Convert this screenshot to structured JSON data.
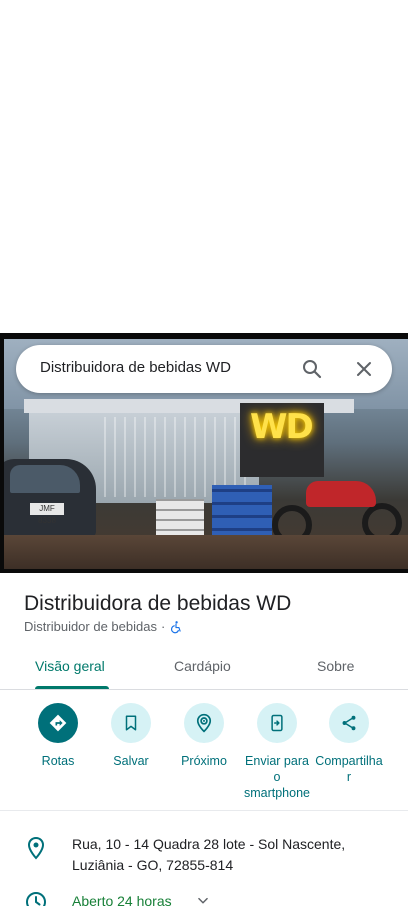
{
  "search": {
    "query": "Distribuidora de bebidas WD"
  },
  "photo": {
    "sign_text": "WD",
    "plate_text": "JMF 8338"
  },
  "place": {
    "title": "Distribuidora de bebidas WD",
    "category": "Distribuidor de bebidas",
    "separator": "·"
  },
  "tabs": [
    {
      "label": "Visão geral",
      "active": true
    },
    {
      "label": "Cardápio",
      "active": false
    },
    {
      "label": "Sobre",
      "active": false
    }
  ],
  "actions": [
    {
      "label": "Rotas",
      "icon": "directions-icon"
    },
    {
      "label": "Salvar",
      "icon": "bookmark-icon"
    },
    {
      "label": "Próximo",
      "icon": "nearby-icon"
    },
    {
      "label_lines": [
        "Enviar para",
        "o",
        "smartphone"
      ],
      "icon": "send-to-phone-icon"
    },
    {
      "label_lines": [
        "Compartilha",
        "r"
      ],
      "icon": "share-icon"
    }
  ],
  "info": {
    "address_line1": "Rua, 10 - 14 Quadra 28 lote - Sol Nascente,",
    "address_line2": "Luziânia - GO, 72855-814",
    "hours": "Aberto 24 horas"
  },
  "colors": {
    "accent": "#00707a",
    "accent_light": "#d6f2f5",
    "open": "#188038",
    "tab_active": "#00796b"
  }
}
